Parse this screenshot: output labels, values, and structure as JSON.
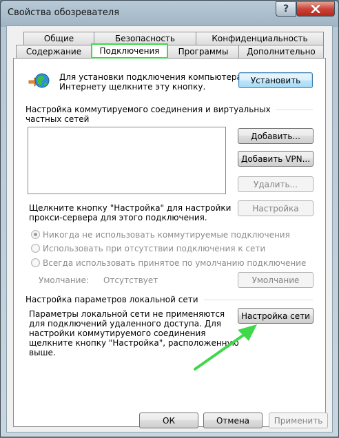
{
  "window": {
    "title": "Свойства обозревателя"
  },
  "tabs_row1": [
    "Общие",
    "Безопасность",
    "Конфиденциальность"
  ],
  "tabs_row2": [
    "Содержание",
    "Подключения",
    "Программы",
    "Дополнительно"
  ],
  "setup": {
    "text_line1": "Для установки подключения компьютера к",
    "text_line2": "Интернету щелкните эту кнопку.",
    "button": "Установить"
  },
  "dialup": {
    "header_line1": "Настройка коммутируемого соединения и виртуальных",
    "header_line2": "частных сетей",
    "add_button": "Добавить...",
    "add_vpn_button": "Добавить VPN...",
    "remove_button": "Удалить...",
    "settings_text_line1": "Щелкните кнопку \"Настройка\" для настройки",
    "settings_text_line2": "прокси-сервера для этого подключения.",
    "settings_button": "Настройка",
    "radio_options": [
      "Никогда не использовать коммутируемые подключения",
      "Использовать при отсутствии подключения к сети",
      "Всегда использовать принятое по умолчанию подключение"
    ],
    "default_label": "Умолчание:",
    "default_value": "Отсутствует",
    "default_button": "Умолчание"
  },
  "lan": {
    "header": "Настройка параметров локальной сети",
    "text_lines": [
      "Параметры локальной сети не применяются",
      "для подключений удаленного доступа. Для",
      "настройки коммутируемого соединения",
      "щелкните кнопку \"Настройка\", расположенную",
      "выше."
    ],
    "button": "Настройка сети"
  },
  "footer": {
    "ok": "ОК",
    "cancel": "Отмена",
    "apply": "Применить"
  },
  "colors": {
    "highlight": "#3fd84a",
    "arrow": "#3fd84a"
  },
  "icons": {
    "help": "question-mark",
    "close": "x",
    "connection": "globe-with-arrow"
  }
}
